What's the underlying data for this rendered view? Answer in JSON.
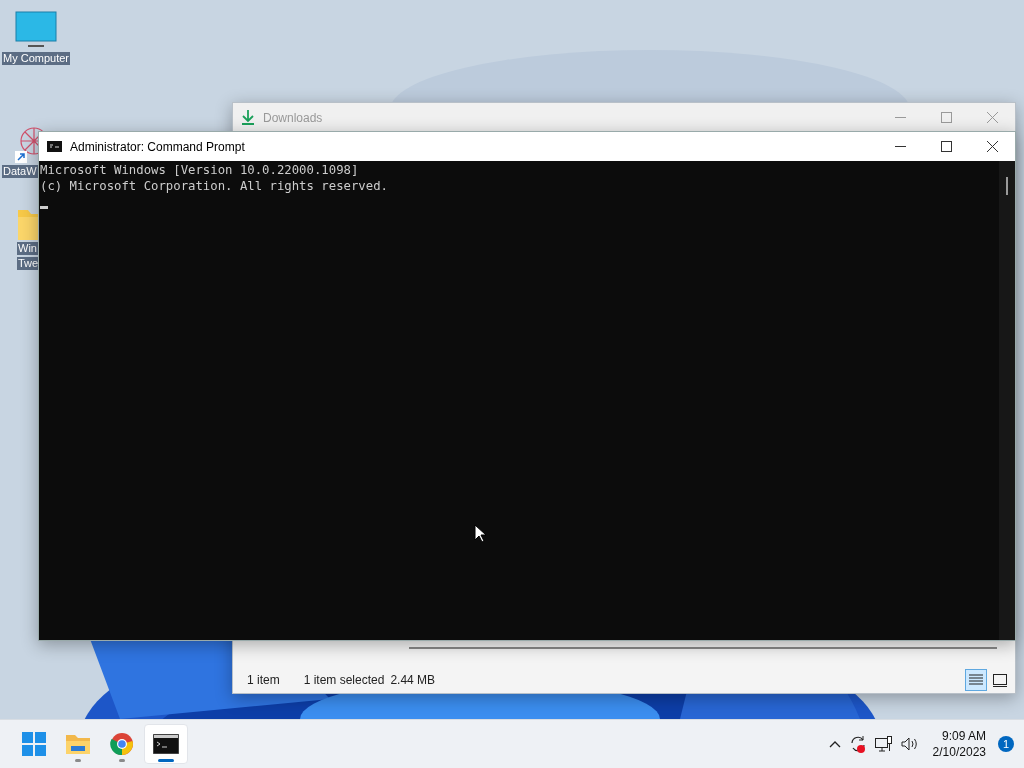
{
  "desktop_icons": [
    {
      "kind": "monitor",
      "lines": [
        "My Computer"
      ]
    },
    {
      "kind": "app",
      "lines": [
        "DataW"
      ]
    },
    {
      "kind": "folder",
      "lines": [
        "Win",
        "Twe"
      ]
    }
  ],
  "downloads_window": {
    "title": "Downloads",
    "active": false,
    "status_items": [
      "1 item",
      "1 item selected",
      "2.44 MB"
    ],
    "view_buttons": [
      {
        "kind": "details",
        "selected": true
      },
      {
        "kind": "tiles",
        "selected": false
      }
    ]
  },
  "command_prompt": {
    "title": "Administrator:  Command Prompt",
    "active": true,
    "lines": [
      "Microsoft Windows [Version 10.0.22000.1098]",
      "(c) Microsoft Corporation. All rights reserved."
    ]
  },
  "taskbar": {
    "apps": [
      {
        "kind": "start",
        "running": false,
        "selected": false
      },
      {
        "kind": "explorer",
        "running": true,
        "selected": false
      },
      {
        "kind": "browser",
        "running": true,
        "selected": false
      },
      {
        "kind": "terminal",
        "running": true,
        "selected": true
      }
    ],
    "time": "9:09 AM",
    "date": "2/10/2023",
    "notifications": "1"
  }
}
